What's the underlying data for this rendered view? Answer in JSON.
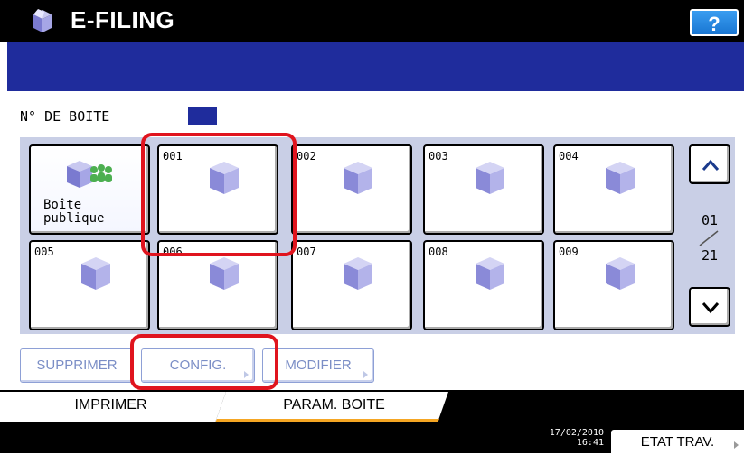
{
  "header": {
    "title": "E-FILING",
    "help_label": "?"
  },
  "box_number": {
    "label": "N° DE BOITE",
    "value": ""
  },
  "public_box": {
    "label": "Boîte\npublique"
  },
  "boxes": [
    {
      "number": "001"
    },
    {
      "number": "002"
    },
    {
      "number": "003"
    },
    {
      "number": "004"
    },
    {
      "number": "005"
    },
    {
      "number": "006"
    },
    {
      "number": "007"
    },
    {
      "number": "008"
    },
    {
      "number": "009"
    }
  ],
  "pagination": {
    "current": "01",
    "total": "21",
    "up_icon": "chevron-up-icon",
    "down_icon": "chevron-down-icon"
  },
  "actions": {
    "delete": "SUPPRIMER",
    "config": "CONFIG.",
    "modify": "MODIFIER"
  },
  "tabs": {
    "print": "IMPRIMER",
    "box_settings": "PARAM. BOITE",
    "active": "PARAM. BOITE"
  },
  "status": {
    "date": "17/02/2010",
    "time": "16:41",
    "job_status": "ETAT TRAV."
  },
  "colors": {
    "header_band": "#1f2c9c",
    "panel": "#c9cfe6",
    "highlight": "#e0141e",
    "active_tab_accent": "#f5a623"
  }
}
